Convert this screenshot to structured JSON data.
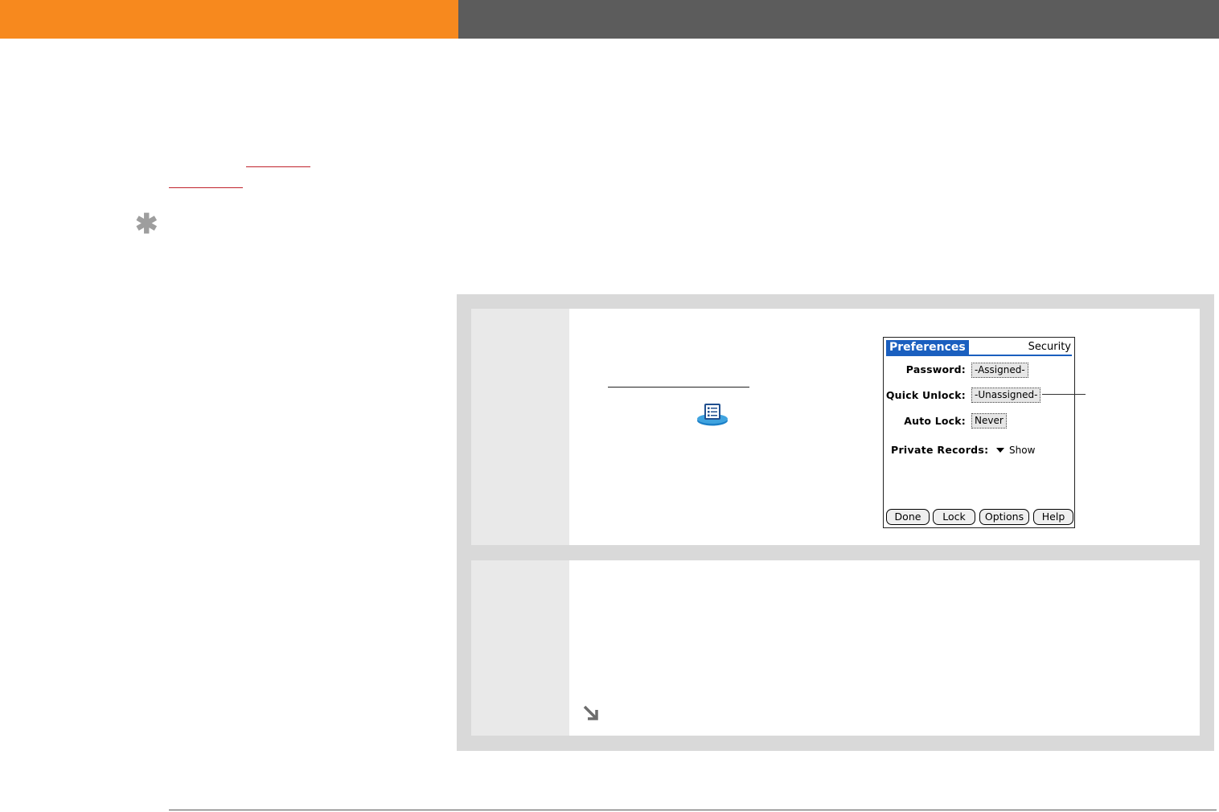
{
  "palm_screen": {
    "title": "Preferences",
    "section": "Security",
    "password_label": "Password:",
    "password_value": "-Assigned-",
    "quick_unlock_label": "Quick Unlock:",
    "quick_unlock_value": "-Unassigned-",
    "auto_lock_label": "Auto Lock:",
    "auto_lock_value": "Never",
    "private_records_label": "Private Records:",
    "private_records_value": "Show",
    "buttons": {
      "done": "Done",
      "lock": "Lock",
      "options": "Options",
      "help": "Help"
    }
  },
  "icons": {
    "tip": "asterisk-icon",
    "prefs_app": "prefs-app-icon",
    "continue": "arrow-down-right-icon"
  },
  "colors": {
    "header_accent": "#f7891e",
    "header_dark": "#5c5c5c",
    "link_red": "#c0222c",
    "palm_title_blue": "#1a5fbf"
  }
}
